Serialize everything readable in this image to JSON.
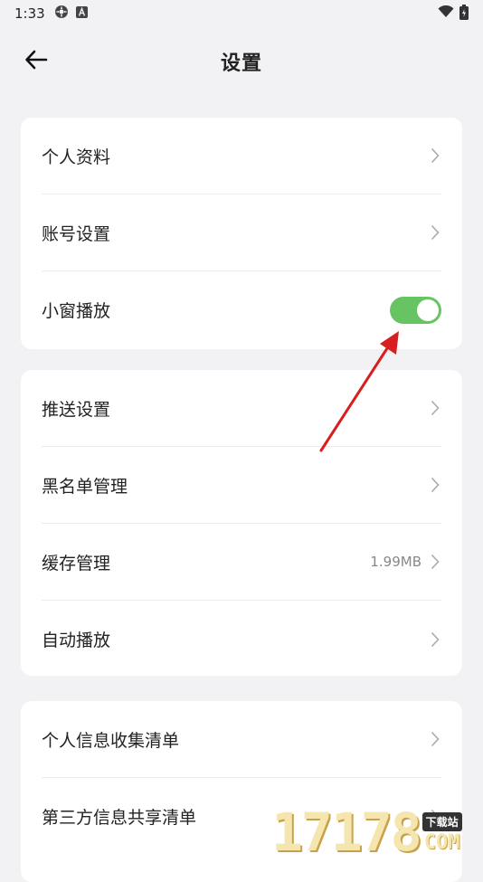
{
  "status_bar": {
    "time": "1:33",
    "icons_left": [
      "settings-gear-icon",
      "a-letter-icon"
    ],
    "icons_right": [
      "wifi-icon",
      "battery-icon"
    ]
  },
  "header": {
    "title": "设置",
    "back_icon": "arrow-left-icon"
  },
  "groups": [
    {
      "items": [
        {
          "label": "个人资料",
          "type": "link"
        },
        {
          "label": "账号设置",
          "type": "link"
        },
        {
          "label": "小窗播放",
          "type": "toggle",
          "on": true
        }
      ]
    },
    {
      "items": [
        {
          "label": "推送设置",
          "type": "link"
        },
        {
          "label": "黑名单管理",
          "type": "link"
        },
        {
          "label": "缓存管理",
          "type": "link",
          "value": "1.99MB"
        },
        {
          "label": "自动播放",
          "type": "link"
        }
      ]
    },
    {
      "items": [
        {
          "label": "个人信息收集清单",
          "type": "link"
        },
        {
          "label": "第三方信息共享清单",
          "type": "link"
        }
      ]
    }
  ],
  "colors": {
    "toggle_on": "#66c562",
    "background": "#f2f2f4",
    "annotation_arrow": "#d81e1e"
  },
  "watermark": {
    "digits": "17178",
    "tag": "下载站",
    "suffix": "COM"
  }
}
